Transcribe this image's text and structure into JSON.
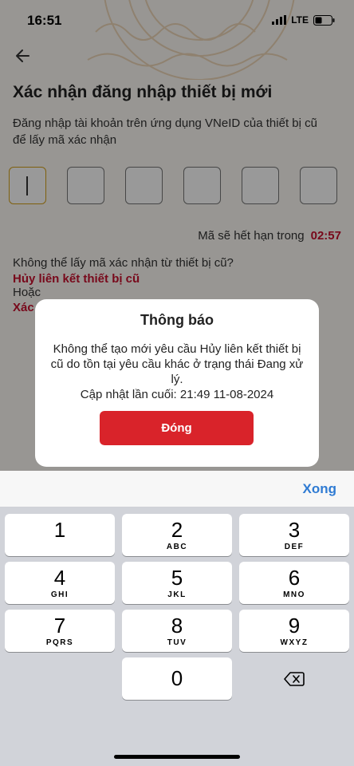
{
  "status_bar": {
    "time": "16:51",
    "network": "LTE"
  },
  "page": {
    "title": "Xác nhận đăng nhập thiết bị mới",
    "subtitle": "Đăng nhập tài khoản trên ứng dụng VNeID của thiết bị cũ để lấy mã xác nhận",
    "expire_label": "Mã sẽ hết hạn trong",
    "timer": "02:57",
    "cannot_get_code": "Không thể lấy mã xác nhận từ thiết bị cũ?",
    "unlink_link": "Hủy liên kết thiết bị cũ",
    "or_text": "Hoặc",
    "confirm_link_partial": "Xác"
  },
  "dialog": {
    "title": "Thông báo",
    "message": "Không thể tạo mới yêu cầu Hủy liên kết thiết bị cũ do tồn tại yêu cầu khác ở trạng thái Đang xử lý.",
    "updated": "Cập nhật lần cuối: 21:49 11-08-2024",
    "button_label": "Đóng"
  },
  "keyboard": {
    "done_label": "Xong",
    "keys": [
      {
        "num": "1",
        "letters": ""
      },
      {
        "num": "2",
        "letters": "ABC"
      },
      {
        "num": "3",
        "letters": "DEF"
      },
      {
        "num": "4",
        "letters": "GHI"
      },
      {
        "num": "5",
        "letters": "JKL"
      },
      {
        "num": "6",
        "letters": "MNO"
      },
      {
        "num": "7",
        "letters": "PQRS"
      },
      {
        "num": "8",
        "letters": "TUV"
      },
      {
        "num": "9",
        "letters": "WXYZ"
      },
      {
        "num": "0",
        "letters": ""
      }
    ]
  },
  "colors": {
    "accent_red": "#c8102e",
    "button_red": "#d9232a",
    "link_blue": "#2f7bd3",
    "active_box": "#d4a017"
  }
}
